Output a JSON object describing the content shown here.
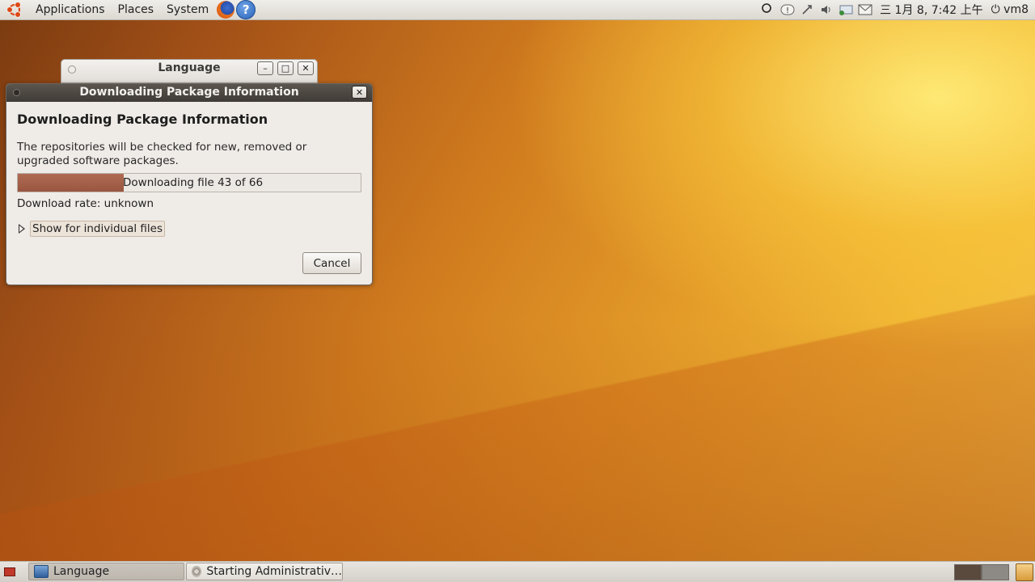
{
  "top_panel": {
    "menus": [
      "Applications",
      "Places",
      "System"
    ],
    "help_glyph": "?",
    "clock": "三 1月  8, 7:42 上午",
    "user": "vm8",
    "tray_icons": [
      "search-icon",
      "info-icon",
      "network-icon",
      "volume-icon",
      "update-icon",
      "mail-icon"
    ]
  },
  "language_window": {
    "title": "Language",
    "minimize": "–",
    "maximize": "□",
    "close": "✕"
  },
  "download_dialog": {
    "title": "Downloading Package Information",
    "close": "✕",
    "heading": "Downloading Package Information",
    "description": "The repositories will be checked for new, removed or upgraded software packages.",
    "progress_text": "Downloading file 43 of 66",
    "progress_fraction": 0.31,
    "rate": "Download rate: unknown",
    "expander_label": "Show for individual files",
    "cancel_label": "Cancel"
  },
  "bottom_panel": {
    "tasks": [
      {
        "label": "Language",
        "active": true
      },
      {
        "label": "Starting Administrativ…",
        "active": false
      }
    ]
  },
  "colors": {
    "accent_orange": "#dd4814",
    "progress_fill": "#a35e47",
    "titlebar_dark": "#4a4540"
  }
}
